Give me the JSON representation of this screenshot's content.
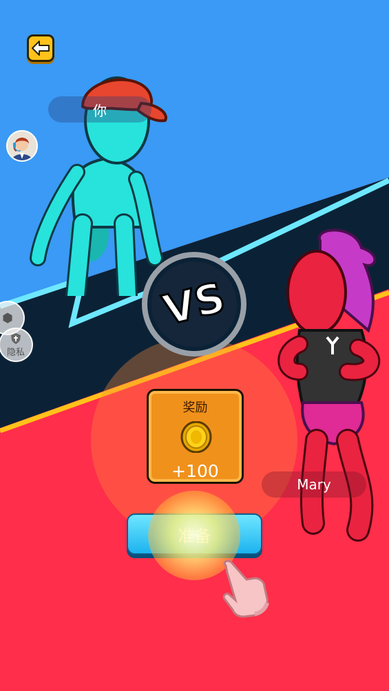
{
  "header": {
    "back_icon": "arrow-left-icon"
  },
  "players": {
    "you": {
      "name": "你",
      "color": "#27e3dc",
      "hat_color": "#e8462e"
    },
    "opponent": {
      "name": "Mary",
      "color": "#ea2340",
      "hair_color": "#c53bc8"
    }
  },
  "vs": {
    "text": "VS"
  },
  "side_buttons": {
    "privacy_label": "隐私"
  },
  "reward": {
    "title": "奖励",
    "amount": "+100",
    "icon": "coin-icon"
  },
  "ready_button": {
    "label": "准备"
  },
  "colors": {
    "top_bg": "#3a9af5",
    "divider": "#0b2236",
    "bottom_bg": "#ff2e4a",
    "accent_cyan": "#6ee8ff",
    "accent_yellow": "#ffc21a"
  }
}
